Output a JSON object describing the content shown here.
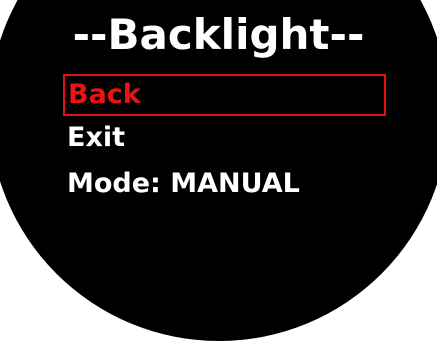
{
  "screen": {
    "title": "--Backlight--"
  },
  "menu": {
    "items": [
      {
        "label": "Back",
        "selected": true
      },
      {
        "label": "Exit",
        "selected": false
      },
      {
        "label": "Mode: MANUAL",
        "selected": false
      }
    ]
  },
  "colors": {
    "background": "#000000",
    "text": "#ffffff",
    "selection": "#e01010"
  }
}
